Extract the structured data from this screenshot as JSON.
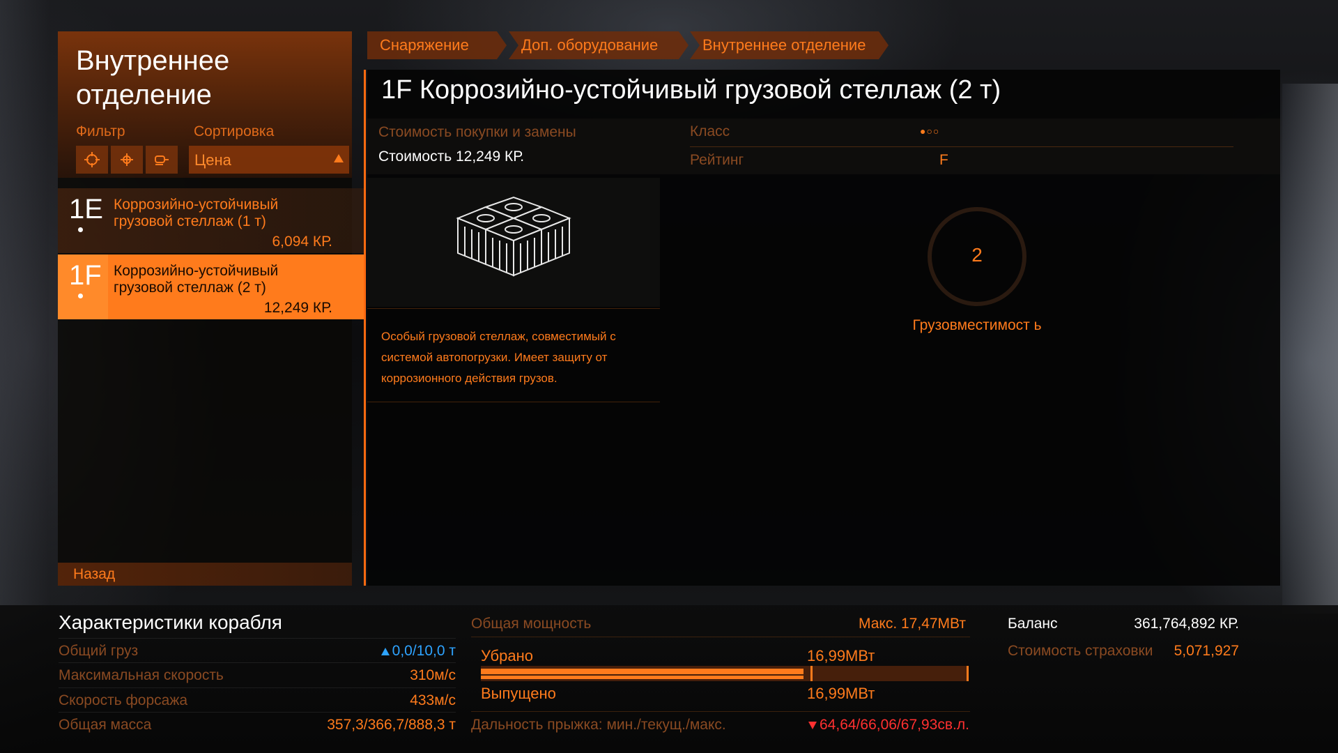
{
  "panel": {
    "title": "Внутреннее отделение",
    "filter_label": "Фильтр",
    "sort_label": "Сортировка",
    "sort_value": "Цена",
    "filter_icons": [
      "crosshair-icon",
      "target-icon",
      "module-icon"
    ],
    "back_label": "Назад"
  },
  "items": [
    {
      "grade": "1E",
      "name": "Коррозийно-устойчивый грузовой стеллаж (1 т)",
      "price": "6,094 КР.",
      "selected": false
    },
    {
      "grade": "1F",
      "name": "Коррозийно-устойчивый грузовой стеллаж (2 т)",
      "price": "12,249 КР.",
      "selected": true
    }
  ],
  "breadcrumbs": [
    "Снаряжение",
    "Доп. оборудование",
    "Внутреннее отделение"
  ],
  "detail": {
    "title": "1F Коррозийно-устойчивый грузовой стеллаж (2 т)",
    "cost_label": "Стоимость покупки и замены",
    "cost_value": "Стоимость 12,249 КР.",
    "class_label": "Класс",
    "class_dots": "●○○",
    "rating_label": "Рейтинг",
    "rating_value": "F",
    "description": "Особый грузовой стеллаж, совместимый с системой автопогрузки. Имеет защиту от коррозионного действия грузов.",
    "capacity_value": "2",
    "capacity_label": "Грузовместимост ь"
  },
  "ship_stats": {
    "title": "Характеристики корабля",
    "rows": [
      {
        "label": "Общий груз",
        "value": "0,0/10,0 т"
      },
      {
        "label": "Максимальная скорость",
        "value": "310м/с"
      },
      {
        "label": "Скорость форсажа",
        "value": "433м/с"
      },
      {
        "label": "Общая масса",
        "value": "357,3/366,7/888,3 т"
      }
    ]
  },
  "power": {
    "title": "Общая мощность",
    "max": "Макс. 17,47МВт",
    "retracted_label": "Убрано",
    "retracted_value": "16,99МВт",
    "deployed_label": "Выпущено",
    "deployed_value": "16,99МВт",
    "usage_fraction": 0.9725,
    "jump_label": "Дальность прыжка: мин./текущ./макс.",
    "jump_value": "64,64/66,06/67,93св.л."
  },
  "finance": {
    "balance_label": "Баланс",
    "balance_value": "361,764,892 КР.",
    "insurance_label": "Стоимость страховки",
    "insurance_value": "5,071,927"
  },
  "colors": {
    "accent": "#ff7b1c",
    "dim_label": "#8a4a22",
    "positive": "#2ea3ff",
    "negative": "#ff3030"
  }
}
